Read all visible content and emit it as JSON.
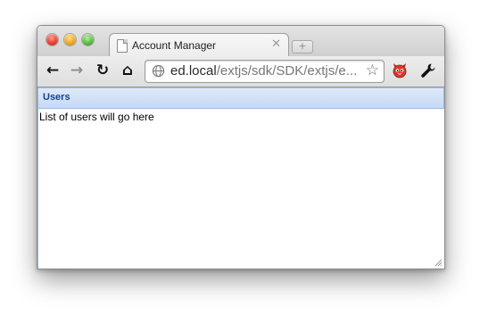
{
  "browser": {
    "tab": {
      "title": "Account Manager",
      "close_glyph": "✕",
      "page_icon": "document-icon"
    },
    "new_tab_glyph": "+",
    "toolbar": {
      "back_glyph": "←",
      "forward_glyph": "→",
      "reload_glyph": "↻",
      "home_glyph": "⌂",
      "address": {
        "host": "ed.local",
        "path": "/extjs/sdk/SDK/extjs/e..."
      },
      "bookmark_glyph": "☆",
      "extension_icon": "devil-face-icon",
      "menu_icon": "wrench-icon"
    },
    "window_buttons": [
      "close",
      "minimize",
      "maximize"
    ]
  },
  "panel": {
    "title": "Users",
    "body_text": "List of users will go here"
  },
  "colors": {
    "panel_header_text": "#15428b",
    "panel_border": "#99bbe8",
    "panel_header_bg": "#c6d9f4"
  }
}
